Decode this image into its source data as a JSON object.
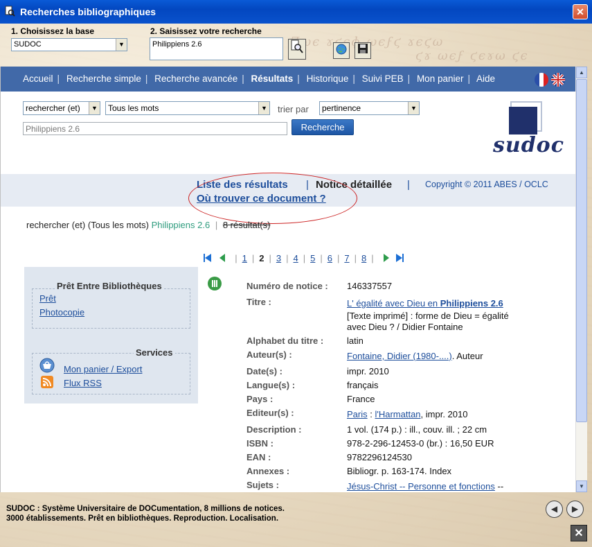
{
  "window": {
    "title": "Recherches bibliographiques"
  },
  "form": {
    "step1_label": "1. Choisissez la base",
    "base_value": "SUDOC",
    "step2_label": "2. Saisissez votre recherche",
    "search_value": "Philippiens 2.6"
  },
  "nav": {
    "items": [
      "Accueil",
      "Recherche simple",
      "Recherche avancée",
      "Résultats",
      "Historique",
      "Suivi PEB",
      "Mon panier",
      "Aide"
    ],
    "active": "Résultats"
  },
  "search": {
    "mode": "rechercher (et)",
    "words": "Tous les mots",
    "sort_label": "trier par",
    "sort_value": "pertinence",
    "query": "Philippiens 2.6",
    "button": "Recherche"
  },
  "logo": {
    "text": "sudoc"
  },
  "tabs": {
    "list": "Liste des résultats",
    "sep": "|",
    "notice": "Notice détaillée",
    "where": "Où trouver ce document ?",
    "copyright": "Copyright © 2011 ABES / OCLC"
  },
  "summary": {
    "prefix": "rechercher (et) (Tous les mots)",
    "query": "Philippiens 2.6",
    "sep": "|",
    "count": "8 résultat(s)"
  },
  "pager": {
    "pages": [
      "1",
      "2",
      "3",
      "4",
      "5",
      "6",
      "7",
      "8"
    ],
    "current": "2"
  },
  "sidebar": {
    "peb_title": "Prêt Entre Bibliothèques",
    "pret": "Prêt",
    "photocopie": "Photocopie",
    "services_title": "Services",
    "panier": "Mon panier / Export",
    "rss": "Flux RSS"
  },
  "record": {
    "numero_label": "Numéro de notice :",
    "numero": "146337557",
    "titre_label": "Titre :",
    "titre_link": "L' égalité avec Dieu en ",
    "titre_bold": "Philippiens 2.6",
    "titre_line2": "[Texte imprimé] : forme de Dieu = égalité",
    "titre_line3": "avec Dieu ? / Didier Fontaine",
    "alphabet_label": "Alphabet du titre :",
    "alphabet": "latin",
    "auteur_label": "Auteur(s) :",
    "auteur_link": "Fontaine, Didier (1980-....)",
    "auteur_role": ". Auteur",
    "date_label": "Date(s) :",
    "date": "impr. 2010",
    "langue_label": "Langue(s) :",
    "langue": "français",
    "pays_label": "Pays :",
    "pays": "France",
    "editeur_label": "Editeur(s) :",
    "editeur_place": "Paris",
    "editeur_sep": " : ",
    "editeur_name": "l'Harmattan",
    "editeur_year": ", impr. 2010",
    "description_label": "Description :",
    "description": "1 vol. (174 p.) : ill., couv. ill. ; 22 cm",
    "isbn_label": "ISBN :",
    "isbn": "978-2-296-12453-0 (br.) : 16,50 EUR",
    "ean_label": "EAN :",
    "ean": "9782296124530",
    "annexes_label": "Annexes :",
    "annexes": "Bibliogr. p. 163-174. Index",
    "sujets_label": "Sujets :",
    "sujets_link": "Jésus-Christ -- Personne et fonctions",
    "sujets_tail": " --"
  },
  "footer": {
    "line1": "SUDOC : Système Universitaire de DOCumentation, 8 millions de notices.",
    "line2": "3000 établissements. Prêt en bibliothèques. Reproduction. Localisation."
  },
  "colors": {
    "titlebar": "#0347c0",
    "navbar": "#4169a8",
    "link": "#1c4d9b",
    "ellipse": "#cc2222"
  }
}
